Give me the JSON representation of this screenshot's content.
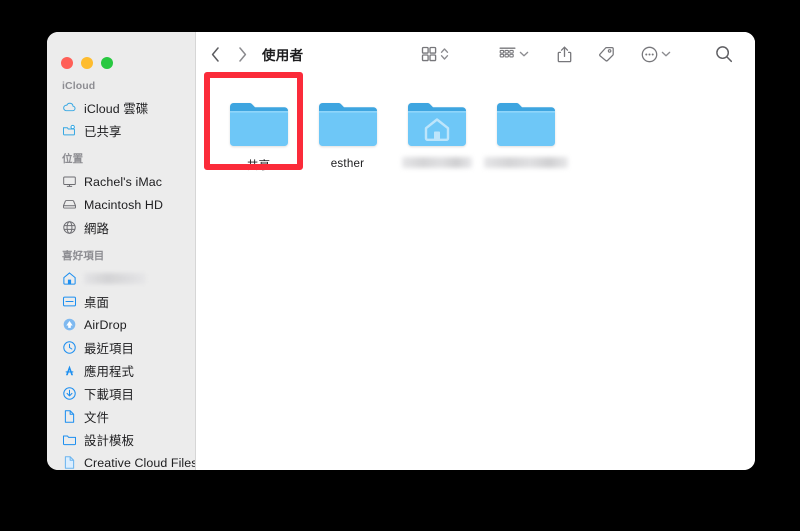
{
  "window": {
    "title": "使用者",
    "traffic_lights": [
      {
        "name": "close",
        "color": "#ff5f57"
      },
      {
        "name": "minimize",
        "color": "#febc2e"
      },
      {
        "name": "maximize",
        "color": "#28c840"
      }
    ]
  },
  "sidebar": {
    "sections": [
      {
        "heading": "iCloud",
        "items": [
          {
            "label": "iCloud 雲碟",
            "icon": "cloud-icon",
            "redacted": false
          },
          {
            "label": "已共享",
            "icon": "shared-folder-icon",
            "redacted": false
          }
        ]
      },
      {
        "heading": "位置",
        "items": [
          {
            "label": "Rachel's iMac",
            "icon": "imac-icon",
            "redacted": false
          },
          {
            "label": "Macintosh HD",
            "icon": "harddisk-icon",
            "redacted": false
          },
          {
            "label": "網路",
            "icon": "network-globe-icon",
            "redacted": false
          }
        ]
      },
      {
        "heading": "喜好項目",
        "items": [
          {
            "label": "",
            "icon": "home-icon",
            "redacted": true
          },
          {
            "label": "桌面",
            "icon": "desktop-icon",
            "redacted": false
          },
          {
            "label": "AirDrop",
            "icon": "airdrop-icon",
            "redacted": false
          },
          {
            "label": "最近項目",
            "icon": "recents-clock-icon",
            "redacted": false
          },
          {
            "label": "應用程式",
            "icon": "applications-icon",
            "redacted": false
          },
          {
            "label": "下載項目",
            "icon": "downloads-icon",
            "redacted": false
          },
          {
            "label": "文件",
            "icon": "document-icon",
            "redacted": false
          },
          {
            "label": "設計模板",
            "icon": "folder-icon",
            "redacted": false
          },
          {
            "label": "Creative Cloud Files",
            "icon": "document-icon",
            "redacted": false
          }
        ]
      }
    ]
  },
  "toolbar": {
    "back_label": "‹",
    "forward_label": "›",
    "path_title": "使用者",
    "buttons": [
      {
        "name": "view-grid-icon",
        "has_chevron": true,
        "chevron": "updown"
      },
      {
        "name": "group-by-icon",
        "has_chevron": true,
        "chevron": "down"
      },
      {
        "name": "share-icon",
        "has_chevron": false,
        "chevron": ""
      },
      {
        "name": "tag-icon",
        "has_chevron": false,
        "chevron": ""
      },
      {
        "name": "more-actions-icon",
        "has_chevron": true,
        "chevron": "down"
      },
      {
        "name": "search-icon",
        "has_chevron": false,
        "chevron": ""
      }
    ]
  },
  "main": {
    "items": [
      {
        "label": "共享",
        "icon": "folder-icon",
        "redacted": false,
        "selected": true,
        "highlighted": true
      },
      {
        "label": "esther",
        "icon": "folder-icon",
        "redacted": false,
        "selected": false,
        "highlighted": false
      },
      {
        "label": "",
        "icon": "home-folder-icon",
        "redacted": true,
        "selected": false,
        "highlighted": false
      },
      {
        "label": "",
        "icon": "folder-icon",
        "redacted": true,
        "selected": false,
        "highlighted": false
      }
    ]
  },
  "annotation": {
    "type": "highlight-rectangle",
    "color": "#fb2b3a",
    "target_label": "共享"
  },
  "colors": {
    "page_background": "#000000",
    "window_background": "#ffffff",
    "sidebar_background": "#ececec",
    "accent_blue": "#3d9bf5",
    "folder_body": "#6ec7f7",
    "folder_tab": "#3ea5e0",
    "annotation_red": "#fb2b3a"
  }
}
